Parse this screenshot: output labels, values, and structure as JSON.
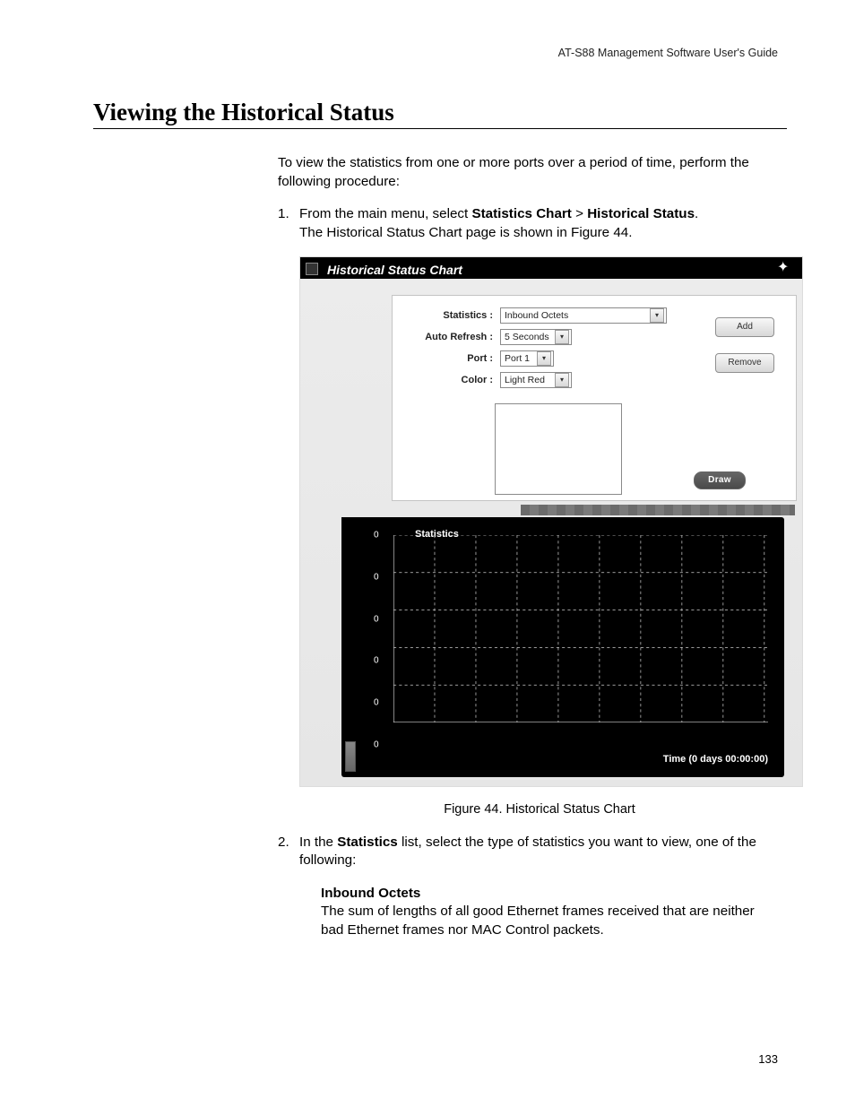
{
  "doc_header": "AT-S88 Management Software User's Guide",
  "section_title": "Viewing the Historical Status",
  "intro": "To view the statistics from one or more ports over a period of time, perform the following procedure:",
  "steps": [
    {
      "num": "1.",
      "text_a": "From the main menu, select ",
      "bold_a": "Statistics Chart",
      "sep": " > ",
      "bold_b": "Historical Status",
      "text_b": ".",
      "sub": "The Historical Status Chart page is shown in Figure 44."
    },
    {
      "num": "2.",
      "text_a": "In the ",
      "bold_a": "Statistics",
      "text_b": " list, select the type of statistics you want to view, one of the following:"
    }
  ],
  "dlg": {
    "title": "Historical Status Chart",
    "labels": {
      "stat": "Statistics :",
      "refresh": "Auto Refresh :",
      "port": "Port :",
      "color": "Color :"
    },
    "values": {
      "stat": "Inbound Octets",
      "refresh": "5 Seconds",
      "port": "Port 1",
      "color": "Light Red"
    },
    "buttons": {
      "add": "Add",
      "remove": "Remove",
      "draw": "Draw"
    }
  },
  "figure_caption": "Figure 44. Historical Status Chart",
  "definition": {
    "term": "Inbound Octets",
    "desc": "The sum of lengths of all good Ethernet frames received that are neither bad Ethernet frames nor MAC Control packets."
  },
  "page_number": "133",
  "chart_data": {
    "type": "line",
    "title": "Statistics",
    "ylabel": "Statistics",
    "xlabel": "Time (0 days 00:00:00)",
    "y_ticks": [
      0,
      0,
      0,
      0,
      0,
      0
    ],
    "x_ticks_count": 9,
    "ylim": [
      0,
      0
    ],
    "series": [],
    "grid": true
  }
}
